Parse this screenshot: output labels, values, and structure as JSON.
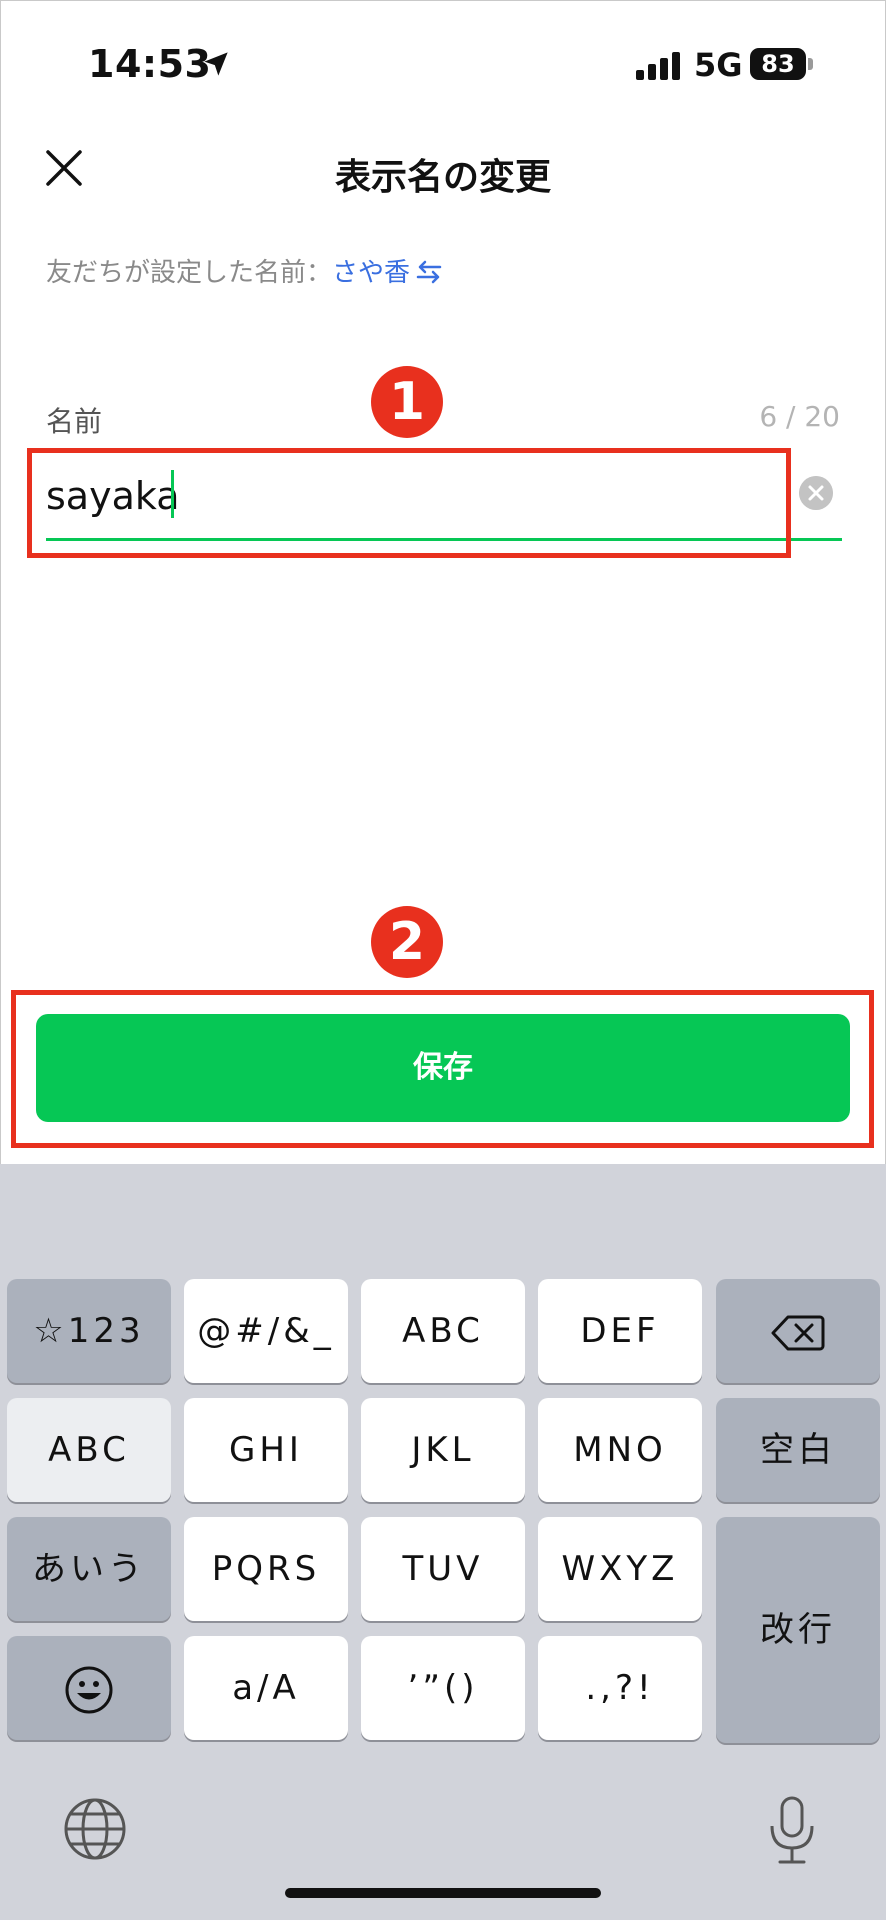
{
  "status_bar": {
    "time": "14:53",
    "network": "5G",
    "battery": "83"
  },
  "header": {
    "title": "表示名の変更"
  },
  "friend_set_name": {
    "label": "友だちが設定した名前：",
    "value": "さや香"
  },
  "markers": [
    "1",
    "2"
  ],
  "name_field": {
    "label": "名前",
    "count": "6 / 20",
    "value": "sayaka"
  },
  "save_button": {
    "label": "保存"
  },
  "keyboard": {
    "keys": {
      "symbols": "☆123",
      "punct": "@#/&_",
      "abc": "ABC",
      "def": "DEF",
      "abc_toggle": "ABC",
      "ghi": "GHI",
      "jkl": "JKL",
      "mno": "MNO",
      "space": "空白",
      "kana": "あいう",
      "pqrs": "PQRS",
      "tuv": "TUV",
      "wxyz": "WXYZ",
      "enter": "改行",
      "case": "a/A",
      "quotes": "’”()",
      "marks": ".,?!"
    }
  },
  "colors": {
    "accent_green": "#06c755",
    "annotation_red": "#e8301e",
    "link_blue": "#3a6fe0"
  }
}
